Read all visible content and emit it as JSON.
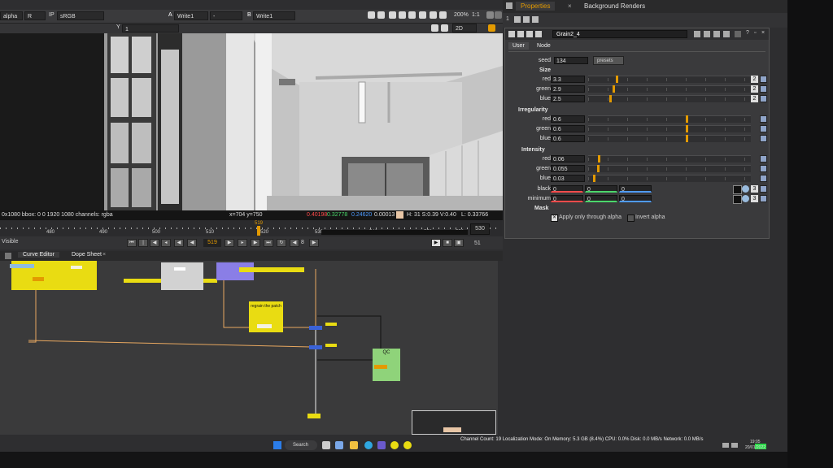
{
  "viewer_toolbar": {
    "channels": "alpha",
    "channel_r": "R",
    "ip_label": "IP",
    "colorspace": "sRGB",
    "input_a_label": "A",
    "input_a": "Write1",
    "input_dash": "-",
    "input_b_label": "B",
    "input_b": "Write1",
    "zoom": "200%",
    "ratio": "1:1",
    "y_label": "Y",
    "y_value": "1",
    "view_mode": "2D"
  },
  "viewer_info": {
    "format": "0x1080  bbox: 0 0 1920 1080 channels: rgba",
    "coords": "x=704 y=750",
    "r": "0.40198",
    "g": "0.32778",
    "b": "0.24620",
    "a": "0.00013",
    "hsv": "H: 31 S:0.39 V:0.40",
    "l": "L: 0.33766"
  },
  "timeline": {
    "ticks": [
      "480",
      "490",
      "500",
      "510",
      "520",
      "530",
      "540",
      "550",
      "556"
    ],
    "current_marker": "519",
    "end_frame": "530",
    "visible_label": "Visible",
    "current_frame": "519",
    "step": "8",
    "fps": "51"
  },
  "node_graph_tabs": [
    "Curve Editor",
    "Dope Sheet"
  ],
  "node_graph": {
    "regrain_label": "regrain the patch",
    "qc_label": "QC"
  },
  "properties_tabs": [
    "Properties",
    "Background Renders"
  ],
  "properties": {
    "node_name": "Grain2_4",
    "tabs": [
      "User",
      "Node"
    ],
    "seed_label": "seed",
    "seed_value": "134",
    "presets_label": "presets",
    "size_section": "Size",
    "size": [
      {
        "label": "red",
        "value": "3.3",
        "pos": 0.17
      },
      {
        "label": "green",
        "value": "2.9",
        "pos": 0.15
      },
      {
        "label": "blue",
        "value": "2.5",
        "pos": 0.13
      }
    ],
    "irregularity_section": "Irregularity",
    "irregularity": [
      {
        "label": "red",
        "value": "0.6",
        "pos": 0.6
      },
      {
        "label": "green",
        "value": "0.6",
        "pos": 0.6
      },
      {
        "label": "blue",
        "value": "0.6",
        "pos": 0.6
      }
    ],
    "intensity_section": "Intensity",
    "intensity": [
      {
        "label": "red",
        "value": "0.06",
        "pos": 0.06
      },
      {
        "label": "green",
        "value": "0.055",
        "pos": 0.055
      },
      {
        "label": "blue",
        "value": "0.03",
        "pos": 0.03
      }
    ],
    "black_label": "black",
    "black_values": [
      "0",
      "0",
      "0"
    ],
    "minimum_label": "minimum",
    "minimum_values": [
      "0",
      "0",
      "0"
    ],
    "mask_section": "Mask",
    "apply_alpha_label": "Apply only through alpha",
    "invert_alpha_label": "Invert alpha",
    "size_count": "2",
    "rgb_count": "3"
  },
  "status": {
    "text": "Channel Count: 19  Localization Mode: On  Memory: 5.3 GB (8.4%)  CPU: 0.0%  Disk: 0.0 MB/s  Network: 0.0 MB/s"
  },
  "taskbar": {
    "search_label": "Search",
    "time": "19:05",
    "date": "20/01/2022"
  },
  "colors": {
    "accent": "#e39a00",
    "node_yellow": "#e9dc12",
    "node_green": "#8fd37a",
    "node_purple": "#8a7ee6",
    "red_value": "#ff4b4b",
    "green_value": "#4bd66b",
    "blue_value": "#4f9bff"
  }
}
